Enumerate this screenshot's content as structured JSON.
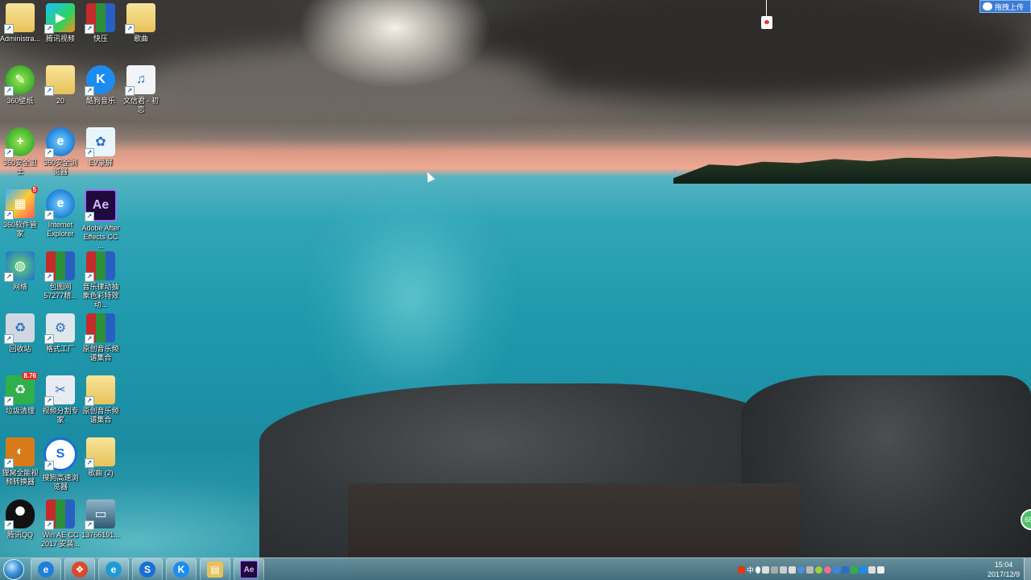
{
  "desktop_icons": [
    {
      "label": "Administra...",
      "icon": "user-folder-icon"
    },
    {
      "label": "腾讯视频",
      "icon": "tencent-video-icon"
    },
    {
      "label": "快压",
      "icon": "winrar-archive-icon"
    },
    {
      "label": "歌曲",
      "icon": "folder-icon"
    },
    {
      "label": "360壁纸",
      "icon": "360-wallpaper-icon"
    },
    {
      "label": "20",
      "icon": "folder-icon"
    },
    {
      "label": "酷狗音乐",
      "icon": "kugou-music-icon"
    },
    {
      "label": "文信君 - 初恋",
      "icon": "mp3-file-icon"
    },
    {
      "label": "360安全卫士",
      "icon": "360-safe-icon"
    },
    {
      "label": "360安全浏览器",
      "icon": "360-browser-icon"
    },
    {
      "label": "EV录屏",
      "icon": "ev-recorder-icon"
    },
    {
      "label": "360软件管家",
      "icon": "360-software-manager-icon",
      "badge": "5"
    },
    {
      "label": "Internet Explorer",
      "icon": "internet-explorer-icon"
    },
    {
      "label": "Adobe After Effects CC ...",
      "icon": "after-effects-icon"
    },
    {
      "label": "网络",
      "icon": "network-icon"
    },
    {
      "label": "包图网 57277精...",
      "icon": "winrar-archive-icon"
    },
    {
      "label": "音乐律动抽象色彩特效动...",
      "icon": "winrar-archive-icon"
    },
    {
      "label": "回收站",
      "icon": "recycle-bin-icon"
    },
    {
      "label": "格式工厂",
      "icon": "format-factory-icon"
    },
    {
      "label": "原创音乐频谱集合",
      "icon": "winrar-archive-icon"
    },
    {
      "label": "垃圾清理",
      "icon": "junk-cleaner-icon",
      "badge": "8.76"
    },
    {
      "label": "视频分割专家",
      "icon": "video-splitter-icon"
    },
    {
      "label": "原创音乐频谱集合",
      "icon": "folder-icon"
    },
    {
      "label": "狸窝全能视频转换器",
      "icon": "video-converter-icon"
    },
    {
      "label": "搜狗高速浏览器",
      "icon": "sogou-browser-icon"
    },
    {
      "label": "歌曲 (2)",
      "icon": "folder-icon"
    },
    {
      "label": "腾讯QQ",
      "icon": "qq-penguin-icon"
    },
    {
      "label": "Win AE CC 2017 安装...",
      "icon": "winrar-archive-icon"
    },
    {
      "label": "13766191...",
      "icon": "image-file-icon"
    }
  ],
  "taskbar": {
    "start": "windows-start-orb",
    "pinned": [
      {
        "name": "ie-taskbar-icon",
        "glyph": "e",
        "color": "#1f7fd8"
      },
      {
        "name": "multicolor-app-taskbar-icon",
        "glyph": "❖",
        "color": "#d94a2a"
      },
      {
        "name": "ie-browser-taskbar-icon",
        "glyph": "e",
        "color": "#1f9ad8"
      },
      {
        "name": "sogou-taskbar-icon",
        "glyph": "S",
        "color": "#1a6fd8"
      },
      {
        "name": "kugou-taskbar-icon",
        "glyph": "K",
        "color": "#1d8cf0"
      },
      {
        "name": "explorer-taskbar-icon",
        "glyph": "▤",
        "color": "#e7c25a"
      },
      {
        "name": "after-effects-taskbar-icon",
        "glyph": "Ae",
        "color": "#1e0a3c"
      }
    ],
    "clock_time": "15:04",
    "clock_date": "2017/12/9",
    "ime_label": "中"
  },
  "overlay": {
    "upload_button": "拖拽上传"
  },
  "colors": {
    "sea": "#1f99ad",
    "taskbar": "#5a93a5"
  }
}
